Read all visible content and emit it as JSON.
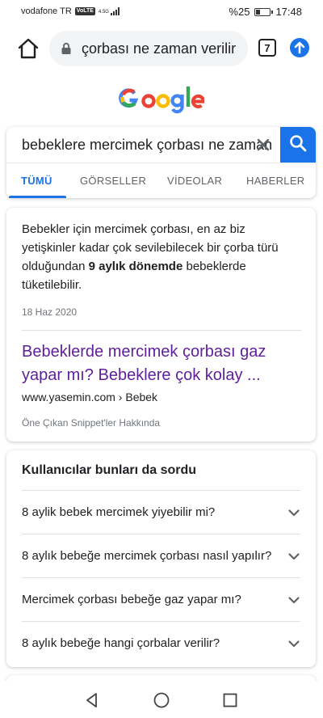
{
  "status_bar": {
    "carrier": "vodafone TR",
    "volte": "VoLTE",
    "network": "4.5G",
    "battery": "%25",
    "battery_level": 0.25,
    "time": "17:48"
  },
  "browser": {
    "url_text": "çorbası ne zaman verilir",
    "tab_count": "7",
    "icons": [
      "home-icon",
      "lock-icon",
      "tabs-icon",
      "update-icon"
    ]
  },
  "search": {
    "query": "bebeklere mercimek çorbası ne zaman",
    "tabs": [
      {
        "label": "TÜMÜ",
        "active": true
      },
      {
        "label": "GÖRSELLER",
        "active": false
      },
      {
        "label": "VİDEOLAR",
        "active": false
      },
      {
        "label": "HABERLER",
        "active": false
      }
    ]
  },
  "snippet": {
    "text_1": "Bebekler için mercimek çorbası, en az biz yetişkinler kadar çok sevilebilecek bir çorba türü olduğundan ",
    "text_bold": "9 aylık dönemde",
    "text_2": " bebeklerde tüketilebilir.",
    "date": "18 Haz 2020",
    "title": "Bebeklerde mercimek çorbası gaz yapar mı? Bebeklere çok kolay ...",
    "url": "www.yasemin.com › Bebek",
    "about": "Öne Çıkan Snippet'ler Hakkında"
  },
  "people_also_ask": {
    "title": "Kullanıcılar bunları da sordu",
    "questions": [
      "8 aylik bebek mercimek yiyebilir mi?",
      "8 aylık bebeğe mercimek çorbası nasıl yapılır?",
      "Mercimek çorbası bebeğe gaz yapar mı?",
      "8 aylık bebeğe hangi çorbalar verilir?"
    ]
  },
  "colors": {
    "accent": "#1a73e8",
    "visited_link": "#5f1f9a",
    "google_blue": "#4285f4",
    "google_red": "#ea4335",
    "google_yellow": "#fbbc05",
    "google_green": "#34a853"
  }
}
